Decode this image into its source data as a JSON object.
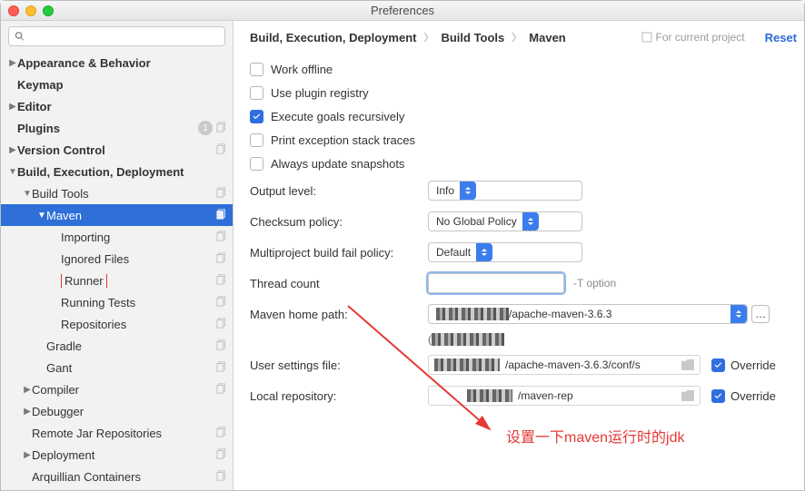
{
  "window": {
    "title": "Preferences"
  },
  "sidebar": {
    "search_placeholder": "",
    "items": [
      {
        "id": "appearance",
        "label": "Appearance & Behavior",
        "bold": true,
        "arrow": "▶",
        "indent": 0,
        "copy": false
      },
      {
        "id": "keymap",
        "label": "Keymap",
        "bold": true,
        "arrow": "",
        "indent": 0,
        "copy": false
      },
      {
        "id": "editor",
        "label": "Editor",
        "bold": true,
        "arrow": "▶",
        "indent": 0,
        "copy": false
      },
      {
        "id": "plugins",
        "label": "Plugins",
        "bold": true,
        "arrow": "",
        "indent": 0,
        "badge": "1",
        "copy": true
      },
      {
        "id": "vcs",
        "label": "Version Control",
        "bold": true,
        "arrow": "▶",
        "indent": 0,
        "copy": true
      },
      {
        "id": "bed",
        "label": "Build, Execution, Deployment",
        "bold": true,
        "arrow": "▼",
        "indent": 0,
        "copy": false
      },
      {
        "id": "buildtools",
        "label": "Build Tools",
        "bold": false,
        "arrow": "▼",
        "indent": 1,
        "copy": true
      },
      {
        "id": "maven",
        "label": "Maven",
        "bold": false,
        "arrow": "▼",
        "indent": 2,
        "copy": true,
        "selected": true
      },
      {
        "id": "importing",
        "label": "Importing",
        "bold": false,
        "arrow": "",
        "indent": 3,
        "copy": true
      },
      {
        "id": "ignored",
        "label": "Ignored Files",
        "bold": false,
        "arrow": "",
        "indent": 3,
        "copy": true
      },
      {
        "id": "runner",
        "label": "Runner",
        "bold": false,
        "arrow": "",
        "indent": 3,
        "copy": true,
        "boxed": true
      },
      {
        "id": "runtests",
        "label": "Running Tests",
        "bold": false,
        "arrow": "",
        "indent": 3,
        "copy": true
      },
      {
        "id": "repos",
        "label": "Repositories",
        "bold": false,
        "arrow": "",
        "indent": 3,
        "copy": true
      },
      {
        "id": "gradle",
        "label": "Gradle",
        "bold": false,
        "arrow": "",
        "indent": 2,
        "copy": true
      },
      {
        "id": "gant",
        "label": "Gant",
        "bold": false,
        "arrow": "",
        "indent": 2,
        "copy": true
      },
      {
        "id": "compiler",
        "label": "Compiler",
        "bold": false,
        "arrow": "▶",
        "indent": 1,
        "copy": true
      },
      {
        "id": "debugger",
        "label": "Debugger",
        "bold": false,
        "arrow": "▶",
        "indent": 1,
        "copy": false
      },
      {
        "id": "remotejar",
        "label": "Remote Jar Repositories",
        "bold": false,
        "arrow": "",
        "indent": 1,
        "copy": true
      },
      {
        "id": "deployment",
        "label": "Deployment",
        "bold": false,
        "arrow": "▶",
        "indent": 1,
        "copy": true
      },
      {
        "id": "arquillian",
        "label": "Arquillian Containers",
        "bold": false,
        "arrow": "",
        "indent": 1,
        "copy": true
      }
    ]
  },
  "header": {
    "crumbs": [
      "Build, Execution, Deployment",
      "Build Tools",
      "Maven"
    ],
    "scope": "For current project",
    "reset": "Reset"
  },
  "form": {
    "checks": [
      {
        "id": "offline",
        "label": "Work offline",
        "on": false
      },
      {
        "id": "plugreg",
        "label": "Use plugin registry",
        "on": false
      },
      {
        "id": "recurse",
        "label": "Execute goals recursively",
        "on": true
      },
      {
        "id": "stacktrace",
        "label": "Print exception stack traces",
        "on": false
      },
      {
        "id": "snapshots",
        "label": "Always update snapshots",
        "on": false
      }
    ],
    "output_level": {
      "label": "Output level:",
      "value": "Info"
    },
    "checksum": {
      "label": "Checksum policy:",
      "value": "No Global Policy"
    },
    "failpolicy": {
      "label": "Multiproject build fail policy:",
      "value": "Default"
    },
    "threadcount": {
      "label": "Thread count",
      "value": "",
      "hint": "-T option"
    },
    "homepath": {
      "label": "Maven home path:",
      "suffix": "/apache-maven-3.6.3"
    },
    "version_prefix": "(",
    "usersettings": {
      "label": "User settings file:",
      "suffix": "/apache-maven-3.6.3/conf/s"
    },
    "localrepo": {
      "label": "Local repository:",
      "suffix": "/maven-rep"
    },
    "override": "Override"
  },
  "annotation": "设置一下maven运行时的jdk"
}
